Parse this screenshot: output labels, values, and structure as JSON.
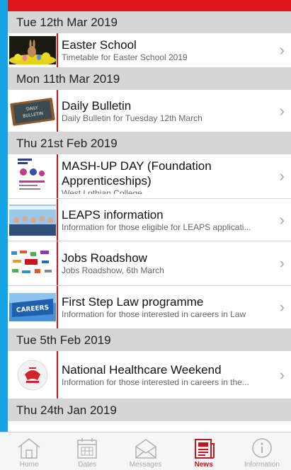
{
  "sections": [
    {
      "date": "Tue 12th Mar 2019",
      "items": [
        {
          "title": "Easter School",
          "subtitle": "Timetable for Easter School 2019"
        }
      ]
    },
    {
      "date": "Mon 11th Mar 2019",
      "items": [
        {
          "title": "Daily Bulletin",
          "subtitle": "Daily Bulletin for Tuesday 12th March",
          "thumb_text": "DAILY BULLETIN"
        }
      ]
    },
    {
      "date": "Thu 21st Feb 2019",
      "items": [
        {
          "title": "MASH-UP DAY (Foundation Apprenticeships)",
          "subtitle": "West Lothian College"
        },
        {
          "title": "LEAPS information",
          "subtitle": "Information for those eligible for LEAPS applicati..."
        },
        {
          "title": "Jobs Roadshow",
          "subtitle": "Jobs Roadshow, 6th March"
        },
        {
          "title": "First Step Law programme",
          "subtitle": "Information for those interested in careers in Law",
          "thumb_text": "CAREERS"
        }
      ]
    },
    {
      "date": "Tue 5th Feb 2019",
      "items": [
        {
          "title": "National Healthcare Weekend",
          "subtitle": "Information for those interested in careers in the..."
        }
      ]
    },
    {
      "date": "Thu 24th Jan 2019",
      "items": []
    }
  ],
  "tabs": [
    {
      "label": "Home",
      "icon": "home-icon"
    },
    {
      "label": "Dates",
      "icon": "calendar-icon"
    },
    {
      "label": "Messages",
      "icon": "envelope-icon"
    },
    {
      "label": "News",
      "icon": "news-icon",
      "active": true
    },
    {
      "label": "Information",
      "icon": "info-icon"
    }
  ],
  "colors": {
    "accent": "#c4161c",
    "top_bar": "#e0161d",
    "frame": "#16a3e6",
    "section_header": "#d6d6d6"
  }
}
